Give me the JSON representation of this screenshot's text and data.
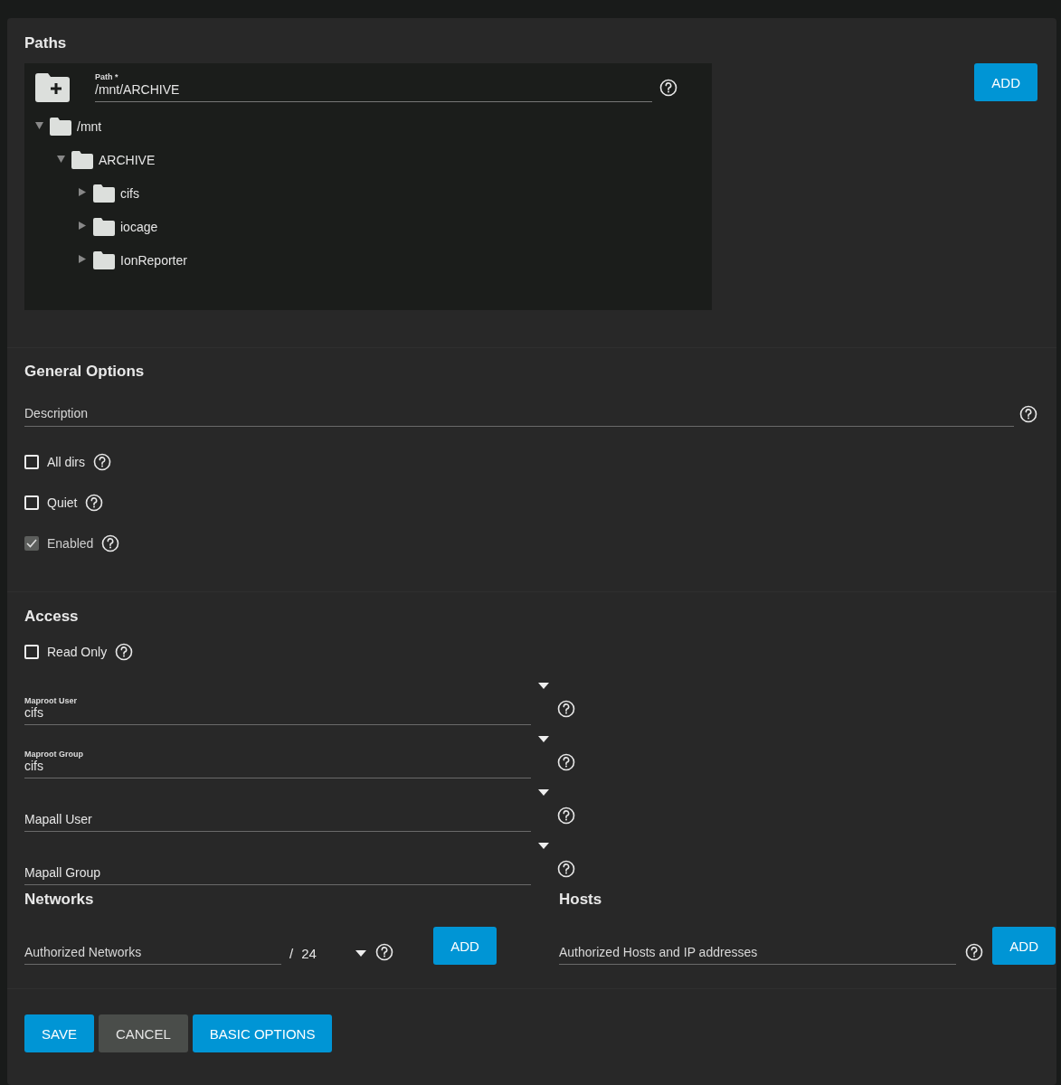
{
  "paths": {
    "title": "Paths",
    "field": {
      "label": "Path *",
      "value": "/mnt/ARCHIVE"
    },
    "tree": [
      {
        "label": "/mnt",
        "expanded": true,
        "children": [
          {
            "label": "ARCHIVE",
            "expanded": true,
            "children": [
              {
                "label": "cifs",
                "expanded": false
              },
              {
                "label": "iocage",
                "expanded": false
              },
              {
                "label": "IonReporter",
                "expanded": false
              }
            ]
          }
        ]
      }
    ],
    "add_button": "ADD"
  },
  "general": {
    "title": "General Options",
    "description": {
      "placeholder": "Description"
    },
    "checkboxes": [
      {
        "label": "All dirs",
        "checked": false,
        "disabled": false
      },
      {
        "label": "Quiet",
        "checked": false,
        "disabled": false
      },
      {
        "label": "Enabled",
        "checked": true,
        "disabled": true
      }
    ]
  },
  "access": {
    "title": "Access",
    "checkboxes": [
      {
        "label": "Read Only",
        "checked": false,
        "disabled": false
      }
    ],
    "selects": [
      {
        "label": "Maproot User",
        "value": "cifs"
      },
      {
        "label": "Maproot Group",
        "value": "cifs"
      },
      {
        "placeholder": "Mapall User"
      },
      {
        "placeholder": "Mapall Group"
      }
    ]
  },
  "networks": {
    "title": "Networks",
    "field": {
      "placeholder": "Authorized Networks"
    },
    "separator": "/",
    "mask": "24",
    "add_button": "ADD"
  },
  "hosts": {
    "title": "Hosts",
    "field": {
      "placeholder": "Authorized Hosts and IP addresses"
    },
    "add_button": "ADD"
  },
  "buttons": [
    {
      "label": "SAVE",
      "kind": "primary"
    },
    {
      "label": "CANCEL",
      "kind": "secondary"
    },
    {
      "label": "BASIC OPTIONS",
      "kind": "primary"
    }
  ]
}
